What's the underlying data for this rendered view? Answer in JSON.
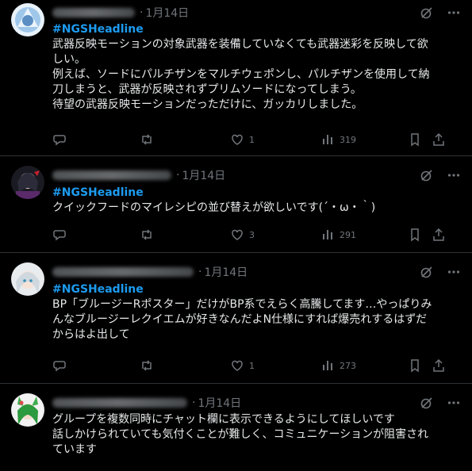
{
  "posts": [
    {
      "date": "1月14日",
      "hashtag": "#NGSHeadline",
      "lines": [
        "武器反映モーションの対象武器を装備していなくても武器迷彩を反映して欲",
        "しい。",
        "例えば、ソードにパルチザンをマルチウェポンし、パルチザンを使用して納",
        "刀しまうと、武器が反映されずプリムソードになってしまう。",
        "待望の武器反映モーションだっただけに、ガッカリしました。"
      ],
      "likes": "1",
      "views": "319"
    },
    {
      "date": "1月14日",
      "hashtag": "#NGSHeadline",
      "lines": [
        "クイックフードのマイレシピの並び替えが欲しいです(´・ω・｀)"
      ],
      "likes": "3",
      "views": "291"
    },
    {
      "date": "1月14日",
      "hashtag": "#NGSHeadline",
      "lines": [
        "BP「ブルージーRポスター」だけがBP系でえらく高騰してます…やっぱりみ",
        "んなブルージーレクイエムが好きなんだよN仕様にすれば爆売れするはずだ",
        "からはよ出して"
      ],
      "likes": "1",
      "views": "273"
    },
    {
      "date": "1月14日",
      "hashtag": "",
      "lines": [
        "グループを複数同時にチャット欄に表示できるようにしてほしいです",
        "話しかけられていても気付くことが難しく、コミュニケーションが阻害され",
        "ています"
      ],
      "likes": "",
      "views": ""
    }
  ],
  "icons": {
    "grok": "grok-icon",
    "more": "more-icon",
    "reply": "reply-icon",
    "repost": "repost-icon",
    "like": "heart-icon",
    "views": "views-icon",
    "bookmark": "bookmark-icon",
    "share": "share-icon"
  },
  "colors": {
    "background": "#000000",
    "text": "#e7e9ea",
    "muted": "#71767b",
    "hashtag": "#1d9bf0",
    "divider": "#2f3336"
  }
}
